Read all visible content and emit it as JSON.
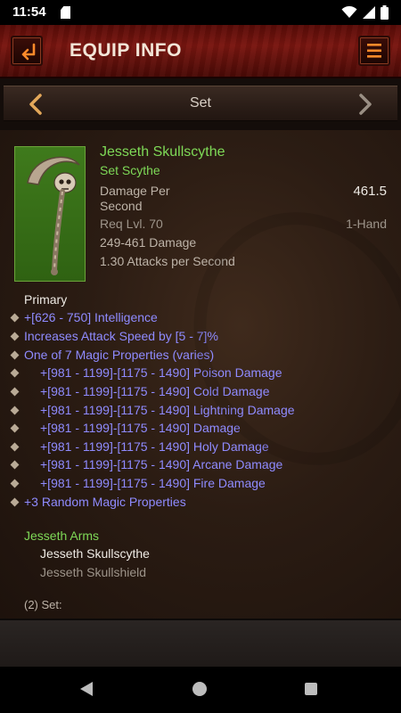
{
  "status_bar": {
    "time": "11:54"
  },
  "header": {
    "title": "EQUIP INFO"
  },
  "selector": {
    "label": "Set"
  },
  "item": {
    "name": "Jesseth Skullscythe",
    "type": "Set Scythe",
    "dps_label": "Damage Per Second",
    "dps_value": "461.5",
    "req_level": "Req Lvl. 70",
    "hand": "1-Hand",
    "damage": "249-461 Damage",
    "attack_speed": "1.30 Attacks per Second"
  },
  "primary_label": "Primary",
  "properties": [
    "+[626 - 750] Intelligence",
    "Increases Attack Speed by [5 - 7]%",
    "One of 7 Magic Properties (varies)",
    "+[981 - 1199]-[1175 - 1490] Poison Damage",
    "+[981 - 1199]-[1175 - 1490] Cold Damage",
    "+[981 - 1199]-[1175 - 1490] Lightning Damage",
    "+[981 - 1199]-[1175 - 1490] Damage",
    "+[981 - 1199]-[1175 - 1490] Holy Damage",
    "+[981 - 1199]-[1175 - 1490] Arcane Damage",
    "+[981 - 1199]-[1175 - 1490] Fire Damage",
    "+3 Random Magic Properties"
  ],
  "set": {
    "name": "Jesseth Arms",
    "items": [
      "Jesseth Skullscythe",
      "Jesseth Skullshield"
    ],
    "bonus_label": "(2) Set:"
  },
  "colors": {
    "set_green": "#7ed957",
    "magic_blue": "#8f8bff",
    "header_red": "#7a1610"
  },
  "icons": {
    "back": "back-arrow-icon",
    "menu": "hamburger-menu-icon",
    "prev": "chevron-left-icon",
    "next": "chevron-right-icon"
  }
}
